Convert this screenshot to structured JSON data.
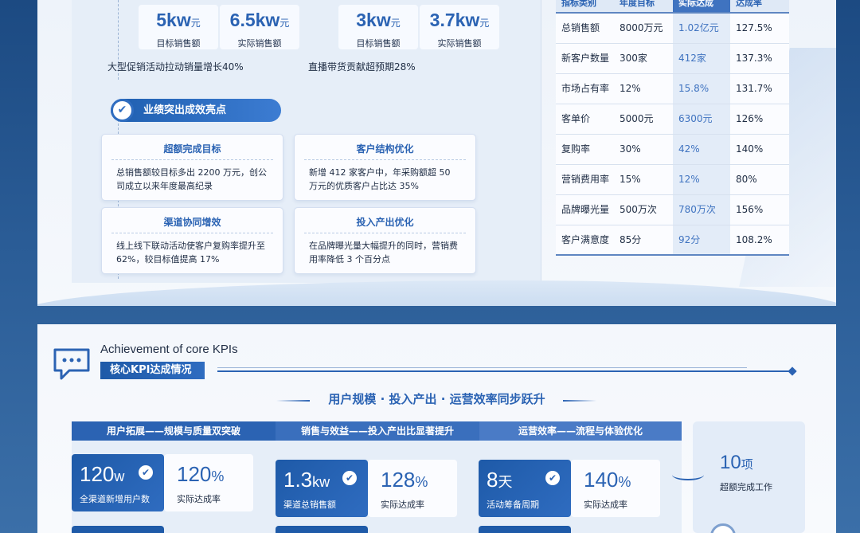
{
  "top": {
    "kpis": [
      {
        "value": "5kw",
        "unit": "元",
        "label": "目标销售额"
      },
      {
        "value": "6.5kw",
        "unit": "元",
        "label": "实际销售额"
      },
      {
        "value": "3kw",
        "unit": "元",
        "label": "目标销售额"
      },
      {
        "value": "3.7kw",
        "unit": "元",
        "label": "实际销售额"
      }
    ],
    "notes": [
      "大型促销活动拉动销量增长40%",
      "直播带货贡献超预期28%"
    ],
    "highlight_title": "业绩突出成效亮点",
    "cards": [
      {
        "title": "超额完成目标",
        "body": "总销售额较目标多出 2200 万元，创公司成立以来年度最高纪录"
      },
      {
        "title": "客户结构优化",
        "body": "新增 412 家客户中，年采购额超 50 万元的优质客户占比达 35%"
      },
      {
        "title": "渠道协同增效",
        "body": "线上线下联动活动使客户复购率提升至 62%，较目标值提高 17%"
      },
      {
        "title": "投入产出优化",
        "body": "在品牌曝光量大幅提升的同时，营销费用率降低 3 个百分点"
      }
    ],
    "table": {
      "headers": [
        "指标类别",
        "年度目标",
        "实际达成",
        "达成率"
      ],
      "rows": [
        [
          "总销售额",
          "8000万元",
          "1.02亿元",
          "127.5%"
        ],
        [
          "新客户数量",
          "300家",
          "412家",
          "137.3%"
        ],
        [
          "市场占有率",
          "12%",
          "15.8%",
          "131.7%"
        ],
        [
          "客单价",
          "5000元",
          "6300元",
          "126%"
        ],
        [
          "复购率",
          "30%",
          "42%",
          "140%"
        ],
        [
          "营销费用率",
          "15%",
          "12%",
          "80%"
        ],
        [
          "品牌曝光量",
          "500万次",
          "780万次",
          "156%"
        ],
        [
          "客户满意度",
          "85分",
          "92分",
          "108.2%"
        ]
      ]
    }
  },
  "bottom": {
    "en_title": "Achievement of core KPIs",
    "cn_title": "核心KPI达成情况",
    "subtitle": "用户规模 · 投入产出 · 运营效率同步跃升",
    "categories": [
      "用户拓展——规模与质量双突破",
      "销售与效益——投入产出比显著提升",
      "运营效率——流程与体验优化"
    ],
    "metrics": [
      {
        "value": "120",
        "unit": "w",
        "label": "全渠道新增用户数",
        "rate": "120",
        "rate_unit": "%",
        "rate_label": "实际达成率"
      },
      {
        "value": "1.3",
        "unit": "kw",
        "label": "渠道总销售额",
        "rate": "128",
        "rate_unit": "%",
        "rate_label": "实际达成率"
      },
      {
        "value": "8",
        "unit": "天",
        "label": "活动筹备周期",
        "rate": "140",
        "rate_unit": "%",
        "rate_label": "实际达成率"
      }
    ],
    "side": {
      "value": "10",
      "unit": "项",
      "label": "超额完成工作"
    }
  },
  "icons": {
    "check": "check-icon",
    "chat": "chat-bubble-icon"
  },
  "colors": {
    "accent": "#2b63b3",
    "dark_blue": "#1e5aa8",
    "background": "#1c4a82"
  }
}
